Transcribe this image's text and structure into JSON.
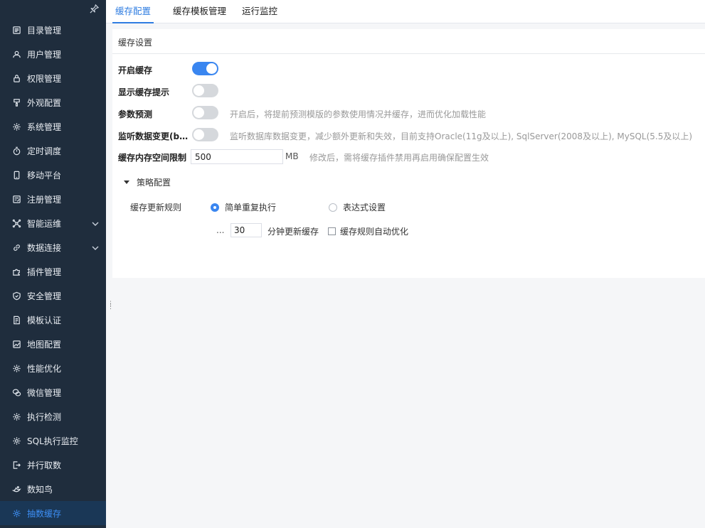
{
  "sidebar": {
    "items": [
      {
        "label": "目录管理",
        "icon": "catalog-icon"
      },
      {
        "label": "用户管理",
        "icon": "user-icon"
      },
      {
        "label": "权限管理",
        "icon": "lock-icon"
      },
      {
        "label": "外观配置",
        "icon": "paint-brush-icon"
      },
      {
        "label": "系统管理",
        "icon": "gear-icon"
      },
      {
        "label": "定时调度",
        "icon": "timer-icon"
      },
      {
        "label": "移动平台",
        "icon": "mobile-icon"
      },
      {
        "label": "注册管理",
        "icon": "register-icon"
      },
      {
        "label": "智能运维",
        "icon": "network-icon",
        "expandable": true
      },
      {
        "label": "数据连接",
        "icon": "link-icon",
        "expandable": true
      },
      {
        "label": "插件管理",
        "icon": "puzzle-icon"
      },
      {
        "label": "安全管理",
        "icon": "shield-icon"
      },
      {
        "label": "模板认证",
        "icon": "template-cert-icon"
      },
      {
        "label": "地图配置",
        "icon": "map-icon"
      },
      {
        "label": "性能优化",
        "icon": "gear-icon"
      },
      {
        "label": "微信管理",
        "icon": "wechat-icon"
      },
      {
        "label": "执行检测",
        "icon": "gear-icon"
      },
      {
        "label": "SQL执行监控",
        "icon": "gear-icon"
      },
      {
        "label": "并行取数",
        "icon": "export-icon"
      },
      {
        "label": "数知鸟",
        "icon": "bird-icon"
      },
      {
        "label": "抽数缓存",
        "icon": "gear-icon",
        "active": true
      }
    ]
  },
  "tabs": [
    {
      "label": "缓存配置",
      "active": true
    },
    {
      "label": "缓存模板管理"
    },
    {
      "label": "运行监控"
    }
  ],
  "settings": {
    "section_title": "缓存设置",
    "enable_cache": {
      "label": "开启缓存",
      "on": true
    },
    "show_hint": {
      "label": "显示缓存提示",
      "on": false
    },
    "param_predict": {
      "label": "参数预测",
      "on": false,
      "hint": "开启后，将提前预测模版的参数使用情况并缓存，进而优化加载性能"
    },
    "listen_change": {
      "label": "监听数据变更(be...",
      "on": false,
      "hint": "监听数据库数据变更，减少额外更新和失效，目前支持Oracle(11g及以上), SqlServer(2008及以上), MySQL(5.5及以上)"
    },
    "memory_limit": {
      "label": "缓存内存空间限制",
      "value": "500",
      "unit": "MB",
      "hint": "修改后，需将缓存插件禁用再启用确保配置生效"
    }
  },
  "strategy": {
    "title": "策略配置",
    "rule_label": "缓存更新规则",
    "options": [
      {
        "label": "简单重复执行",
        "checked": true
      },
      {
        "label": "表达式设置",
        "checked": false
      }
    ],
    "ellipsis": "...",
    "minutes_value": "30",
    "minutes_unit": "分钟更新缓存",
    "auto_optimize_label": "缓存规则自动优化"
  },
  "colors": {
    "sidebar_bg": "#1f2d3d",
    "accent": "#3a86f0"
  }
}
